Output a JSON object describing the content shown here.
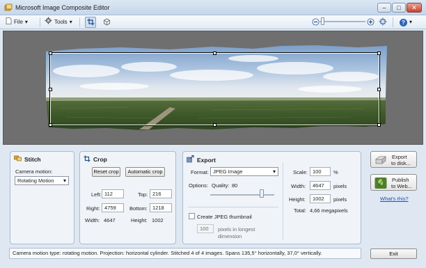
{
  "window": {
    "title": "Microsoft Image Composite Editor",
    "minimize": "–",
    "maximize": "□",
    "close": "✕"
  },
  "toolbar": {
    "file_label": "File",
    "tools_label": "Tools",
    "help_icon_label": "?",
    "icons": [
      "crop-tool-icon",
      "rotate-tool-icon",
      "zoom-out-icon",
      "zoom-in-icon",
      "fit-to-window-icon",
      "help-icon"
    ],
    "zoom_level": 0.03
  },
  "stitch": {
    "title": "Stitch",
    "camera_motion_label": "Camera motion:",
    "camera_motion_value": "Rotating Motion"
  },
  "crop": {
    "title": "Crop",
    "reset_label": "Reset crop",
    "automatic_label": "Automatic crop",
    "left_label": "Left:",
    "left_value": "112",
    "top_label": "Top:",
    "top_value": "216",
    "right_label": "Right:",
    "right_value": "4759",
    "bottom_label": "Bottom:",
    "bottom_value": "1218",
    "width_label": "Width:",
    "width_value": "4647",
    "height_label": "Height:",
    "height_value": "1002"
  },
  "export": {
    "title": "Export",
    "format_label": "Format:",
    "format_value": "JPEG Image",
    "options_label": "Options:",
    "quality_label": "Quality:",
    "quality_value": "80",
    "quality_slider": 0.8,
    "thumbnail_label": "Create JPEG thumbnail",
    "thumbnail_checked": false,
    "thumbnail_size": "100",
    "thumbnail_desc_1": "pixels in longest",
    "thumbnail_desc_2": "dimension",
    "scale_label": "Scale:",
    "scale_value": "100",
    "scale_unit": "%",
    "width_label": "Width:",
    "width_value": "4647",
    "width_unit": "pixels",
    "height_label": "Height:",
    "height_value": "1002",
    "height_unit": "pixels",
    "total_label": "Total:",
    "total_value": "4,66 megapixels"
  },
  "actions": {
    "export_disk_line1": "Export",
    "export_disk_line2": "to disk...",
    "publish_line1": "Publish",
    "publish_line2": "to Web...",
    "whats_this": "What's this?",
    "exit_label": "Exit"
  },
  "status": {
    "text": "Camera motion type: rotating motion. Projection: horizontal cylinder. Stitched 4 of 4 images. Spans 135,5° horizontally, 37,0° vertically."
  },
  "colors": {
    "canvas_bg": "#6f6f6f",
    "link": "#1a4fc4",
    "accent": "#7da2ce"
  }
}
